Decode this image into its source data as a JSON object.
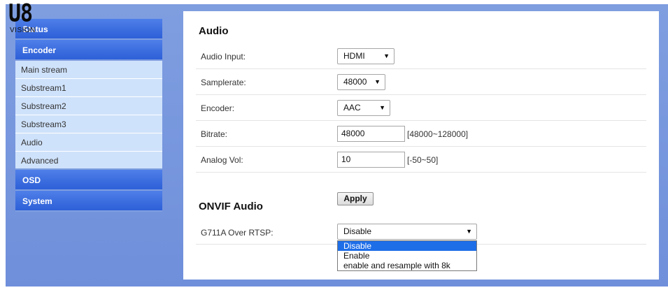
{
  "logo": {
    "main": "U8",
    "sub": "VISION"
  },
  "sidebar": {
    "status": "Status",
    "encoder": "Encoder",
    "encoder_items": [
      "Main stream",
      "Substream1",
      "Substream2",
      "Substream3",
      "Audio",
      "Advanced"
    ],
    "osd": "OSD",
    "system": "System"
  },
  "audio": {
    "title": "Audio",
    "input_label": "Audio Input:",
    "input_value": "HDMI",
    "samplerate_label": "Samplerate:",
    "samplerate_value": "48000",
    "encoder_label": "Encoder:",
    "encoder_value": "AAC",
    "bitrate_label": "Bitrate:",
    "bitrate_value": "48000",
    "bitrate_range": "[48000~128000]",
    "analog_label": "Analog Vol:",
    "analog_value": "10",
    "analog_range": "[-50~50]",
    "apply_label": "Apply"
  },
  "onvif": {
    "title": "ONVIF Audio",
    "g711_label": "G711A Over RTSP:",
    "g711_value": "Disable",
    "options": [
      "Disable",
      "Enable",
      "enable and resample with 8k"
    ]
  },
  "colors": {
    "nav_blue": "#2d5fd8",
    "sub_bg": "#cfe2fb",
    "frame_bg": "#7f9ee0",
    "selected": "#1e6ee8"
  }
}
